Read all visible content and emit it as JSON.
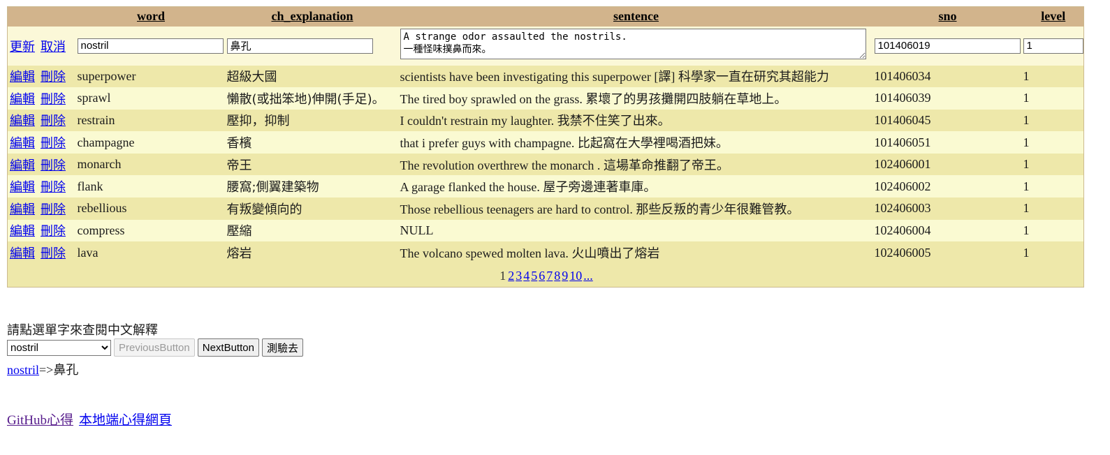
{
  "columns": {
    "word": "word",
    "ch_explanation": "ch_explanation",
    "sentence": "sentence",
    "sno": "sno",
    "level": "level"
  },
  "edit_row": {
    "update_label": "更新",
    "cancel_label": "取消",
    "word": "nostril",
    "ch_explanation": "鼻孔",
    "sentence": "A strange odor assaulted the nostrils.\n一種怪味撲鼻而來。",
    "sno": "101406019",
    "level": "1"
  },
  "row_actions": {
    "edit": "編輯",
    "delete": "刪除"
  },
  "rows": [
    {
      "word": "superpower",
      "ch_explanation": "超級大國",
      "sentence": "scientists have been investigating this superpower [譯] 科學家一直在研究其超能力",
      "sno": "101406034",
      "level": "1"
    },
    {
      "word": "sprawl",
      "ch_explanation": "懶散(或拙笨地)伸開(手足)。",
      "sentence": "The tired boy sprawled on the grass. 累壞了的男孩攤開四肢躺在草地上。",
      "sno": "101406039",
      "level": "1"
    },
    {
      "word": "restrain",
      "ch_explanation": "壓抑，抑制",
      "sentence": "I couldn't restrain my laughter. 我禁不住笑了出來。",
      "sno": "101406045",
      "level": "1"
    },
    {
      "word": "champagne",
      "ch_explanation": "香檳",
      "sentence": "that i prefer guys with champagne. 比起窩在大學裡喝酒把妹。",
      "sno": "101406051",
      "level": "1"
    },
    {
      "word": "monarch",
      "ch_explanation": "帝王",
      "sentence": "The revolution overthrew the monarch . 這場革命推翻了帝王。",
      "sno": "102406001",
      "level": "1"
    },
    {
      "word": "flank",
      "ch_explanation": "腰窩;側翼建築物",
      "sentence": "A garage flanked the house. 屋子旁邊連著車庫。",
      "sno": "102406002",
      "level": "1"
    },
    {
      "word": "rebellious",
      "ch_explanation": "有叛變傾向的",
      "sentence": "Those rebellious teenagers are hard to control. 那些反叛的青少年很難管教。",
      "sno": "102406003",
      "level": "1"
    },
    {
      "word": "compress",
      "ch_explanation": "壓縮",
      "sentence": "NULL",
      "sno": "102406004",
      "level": "1"
    },
    {
      "word": "lava",
      "ch_explanation": "熔岩",
      "sentence": "The volcano spewed molten lava. 火山噴出了熔岩",
      "sno": "102406005",
      "level": "1"
    }
  ],
  "pager": {
    "current": "1",
    "pages": [
      "2",
      "3",
      "4",
      "5",
      "6",
      "7",
      "8",
      "9",
      "10",
      "..."
    ]
  },
  "quiz": {
    "label": "請點選單字來查閱中文解釋",
    "selected": "nostril",
    "prev_button": "PreviousButton",
    "next_button": "NextButton",
    "test_button": "測驗去",
    "answer_word": "nostril",
    "answer_arrow": "=>",
    "answer_meaning": "鼻孔"
  },
  "footer": {
    "github_link": "GitHub心得",
    "local_link": "本地端心得網頁"
  }
}
